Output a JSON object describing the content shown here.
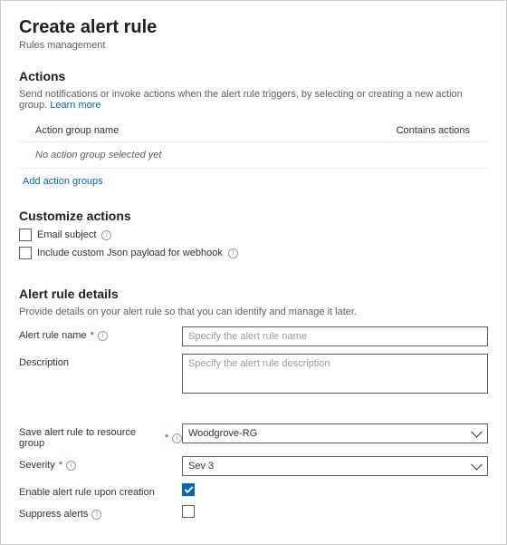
{
  "header": {
    "title": "Create alert rule",
    "subtitle": "Rules management"
  },
  "actions": {
    "heading": "Actions",
    "description": "Send notifications or invoke actions when the alert rule triggers, by selecting or creating a new action group. ",
    "learn_more": "Learn more",
    "columns": {
      "name": "Action group name",
      "contains": "Contains actions"
    },
    "empty": "No action group selected yet",
    "add_link": "Add action groups"
  },
  "customize": {
    "heading": "Customize actions",
    "email_subject": "Email subject",
    "custom_json": "Include custom Json payload for webhook"
  },
  "details": {
    "heading": "Alert rule details",
    "description": "Provide details on your alert rule so that you can identify and manage it later.",
    "name_label": "Alert rule name",
    "name_placeholder": "Specify the alert rule name",
    "desc_label": "Description",
    "desc_placeholder": "Specify the alert rule description",
    "rg_label": "Save alert rule to resource group",
    "rg_value": "Woodgrove-RG",
    "severity_label": "Severity",
    "severity_value": "Sev 3",
    "enable_label": "Enable alert rule upon creation",
    "suppress_label": "Suppress alerts"
  }
}
